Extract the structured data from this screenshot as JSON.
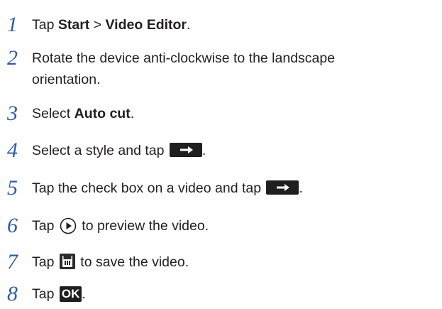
{
  "steps": [
    {
      "num": "1",
      "t1": "Tap ",
      "b1": "Start",
      "t2": " > ",
      "b2": "Video Editor",
      "t3": "."
    },
    {
      "num": "2",
      "line1": "Rotate the device anti-clockwise to the landscape",
      "line2": "orientation."
    },
    {
      "num": "3",
      "t1": "Select ",
      "b1": "Auto cut",
      "t2": "."
    },
    {
      "num": "4",
      "t1": "Select a style and tap ",
      "t2": "."
    },
    {
      "num": "5",
      "t1": "Tap the check box on a video and tap ",
      "t2": "."
    },
    {
      "num": "6",
      "t1": "Tap ",
      "t2": " to preview the video."
    },
    {
      "num": "7",
      "t1": "Tap ",
      "t2": " to save the video."
    },
    {
      "num": "8",
      "t1": "Tap ",
      "ok_label": "OK",
      "t2": "."
    }
  ],
  "icons": {
    "next": "arrow-right-icon",
    "play": "play-icon",
    "save": "save-icon",
    "ok": "ok-button-icon"
  },
  "colors": {
    "step_number": "#2f5ba8",
    "text": "#231f20",
    "icon_dark": "#1f1f1f"
  }
}
